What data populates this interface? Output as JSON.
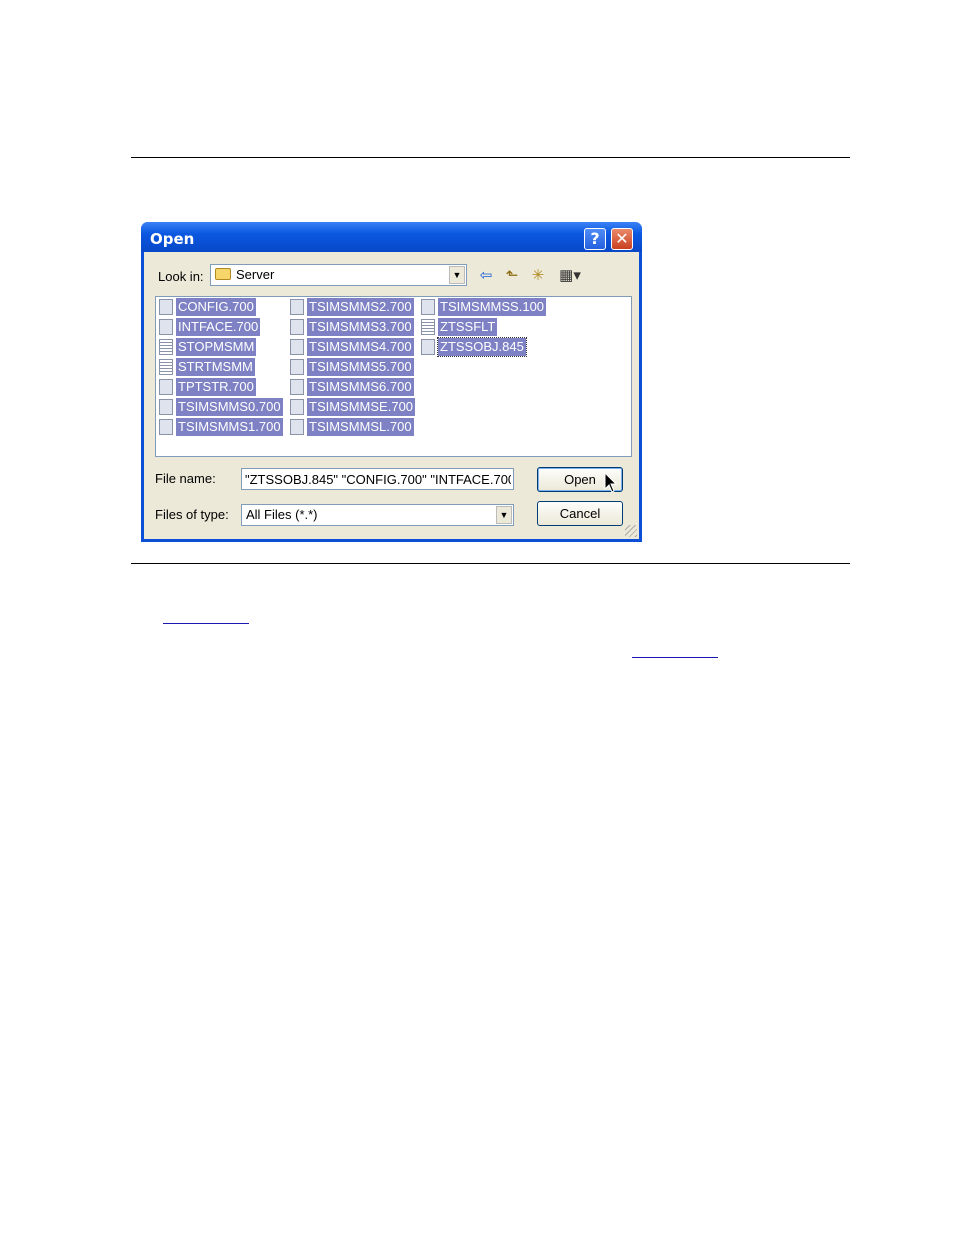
{
  "dialog": {
    "title": "Open",
    "help_label": "?",
    "close_label": "✕",
    "look_in_label": "Look in:",
    "look_in_value": "Server",
    "files": [
      {
        "name": "CONFIG.700",
        "icon": "dll-file-icon"
      },
      {
        "name": "INTFACE.700",
        "icon": "dll-file-icon"
      },
      {
        "name": "STOPMSMM",
        "icon": "text-file-icon"
      },
      {
        "name": "STRTMSMM",
        "icon": "text-file-icon"
      },
      {
        "name": "TPTSTR.700",
        "icon": "dll-file-icon"
      },
      {
        "name": "TSIMSMMS0.700",
        "icon": "dll-file-icon"
      },
      {
        "name": "TSIMSMMS1.700",
        "icon": "dll-file-icon"
      },
      {
        "name": "TSIMSMMS2.700",
        "icon": "dll-file-icon"
      },
      {
        "name": "TSIMSMMS3.700",
        "icon": "dll-file-icon"
      },
      {
        "name": "TSIMSMMS4.700",
        "icon": "dll-file-icon"
      },
      {
        "name": "TSIMSMMS5.700",
        "icon": "dll-file-icon"
      },
      {
        "name": "TSIMSMMS6.700",
        "icon": "dll-file-icon"
      },
      {
        "name": "TSIMSMMSE.700",
        "icon": "dll-file-icon"
      },
      {
        "name": "TSIMSMMSL.700",
        "icon": "dll-file-icon"
      },
      {
        "name": "TSIMSMMSS.100",
        "icon": "dll-file-icon"
      },
      {
        "name": "ZTSSFLT",
        "icon": "text-file-icon"
      },
      {
        "name": "ZTSSOBJ.845",
        "icon": "dll-file-icon"
      }
    ],
    "file_name_label": "File name:",
    "file_name_value": "\"ZTSSOBJ.845\" \"CONFIG.700\" \"INTFACE.700",
    "files_of_type_label": "Files of type:",
    "files_of_type_value": "All Files (*.*)",
    "open_button": "Open",
    "cancel_button": "Cancel"
  },
  "colors": {
    "selection": "#7e82c4",
    "titlebar": "#0a57e0",
    "dialog_bg": "#ece9d8"
  }
}
